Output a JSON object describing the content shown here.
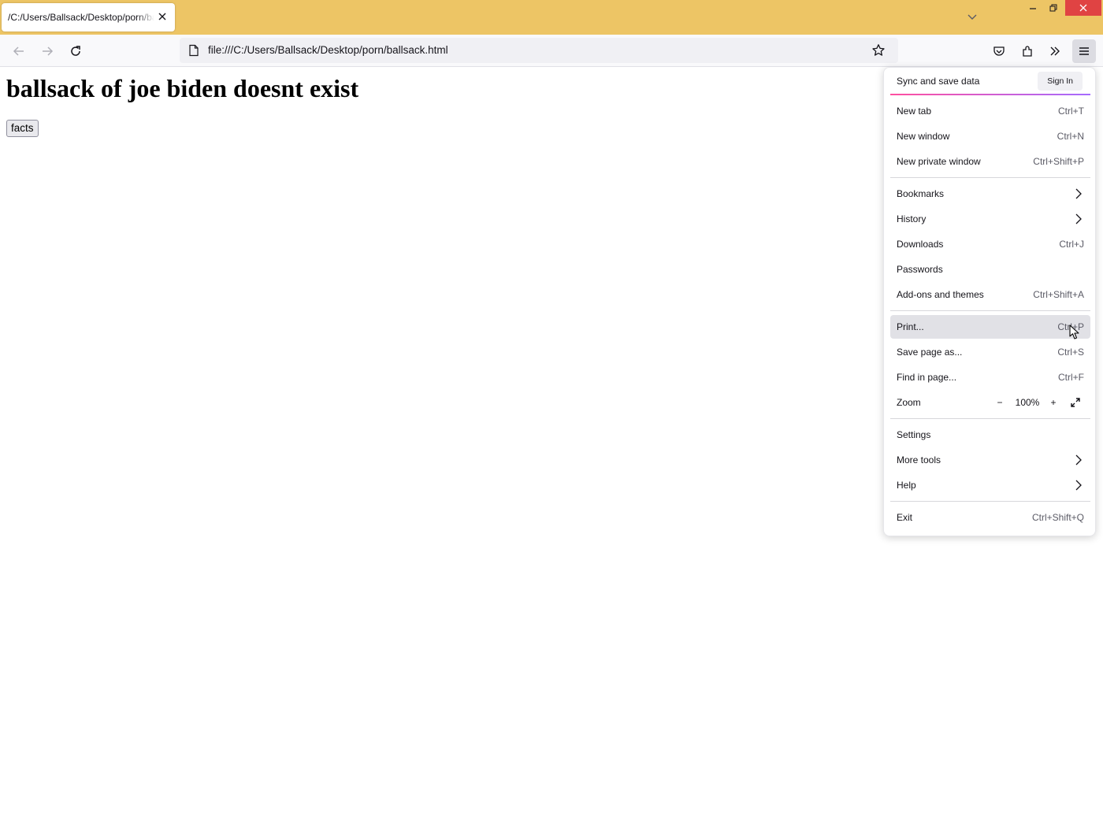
{
  "browser": {
    "tab": {
      "title": "/C:/Users/Ballsack/Desktop/porn/ballsack.html"
    },
    "url": "file:///C:/Users/Ballsack/Desktop/porn/ballsack.html"
  },
  "page": {
    "heading": "ballsack of joe biden doesnt exist",
    "button_label": "facts"
  },
  "app_menu": {
    "sync_label": "Sync and save data",
    "sign_in_label": "Sign In",
    "items": [
      {
        "label": "New tab",
        "shortcut": "Ctrl+T"
      },
      {
        "label": "New window",
        "shortcut": "Ctrl+N"
      },
      {
        "label": "New private window",
        "shortcut": "Ctrl+Shift+P"
      },
      {
        "label": "Bookmarks",
        "shortcut": ""
      },
      {
        "label": "History",
        "shortcut": ""
      },
      {
        "label": "Downloads",
        "shortcut": "Ctrl+J"
      },
      {
        "label": "Passwords",
        "shortcut": ""
      },
      {
        "label": "Add-ons and themes",
        "shortcut": "Ctrl+Shift+A"
      },
      {
        "label": "Print...",
        "shortcut": "Ctrl+P"
      },
      {
        "label": "Save page as...",
        "shortcut": "Ctrl+S"
      },
      {
        "label": "Find in page...",
        "shortcut": "Ctrl+F"
      },
      {
        "label": "Zoom",
        "shortcut": ""
      },
      {
        "label": "Settings",
        "shortcut": ""
      },
      {
        "label": "More tools",
        "shortcut": ""
      },
      {
        "label": "Help",
        "shortcut": ""
      },
      {
        "label": "Exit",
        "shortcut": "Ctrl+Shift+Q"
      }
    ],
    "zoom": {
      "minus": "−",
      "level": "100%",
      "plus": "+"
    }
  },
  "colors": {
    "titlebar": "#edc565",
    "close_button": "#e04343",
    "menu_hover": "#e1e1e6"
  },
  "icons": [
    "back-arrow-icon",
    "forward-arrow-icon",
    "reload-icon",
    "page-icon",
    "star-icon",
    "pocket-icon",
    "extensions-icon",
    "overflow-chevrons-icon",
    "hamburger-menu-icon",
    "chevron-right-icon",
    "fullscreen-icon",
    "close-icon",
    "chevron-down-icon",
    "minimize-icon",
    "restore-icon"
  ]
}
